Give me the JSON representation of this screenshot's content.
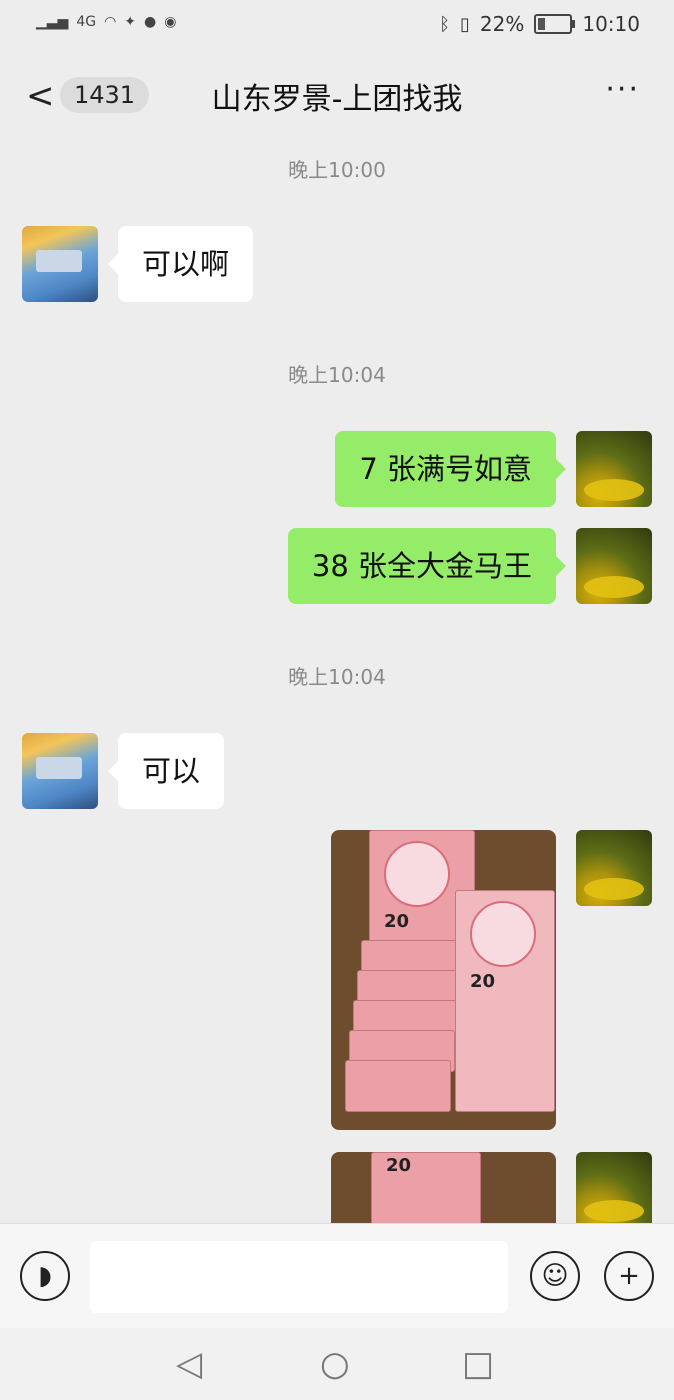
{
  "status_bar": {
    "signal_text": "4G",
    "battery": "22%",
    "battery_level": 0.22,
    "time": "10:10",
    "icons": [
      "signal-icon",
      "wifi-icon",
      "notification-icon",
      "chat-icon",
      "app-icon",
      "bluetooth-icon",
      "vibrate-icon",
      "battery-icon"
    ]
  },
  "header": {
    "back_label": "<",
    "unread_count": "1431",
    "title": "山东罗景-上团找我",
    "more_label": "···"
  },
  "messages": [
    {
      "type": "time",
      "text": "晚上10:00"
    },
    {
      "type": "text",
      "side": "left",
      "text": "可以啊"
    },
    {
      "type": "time",
      "text": "晚上10:04"
    },
    {
      "type": "text",
      "side": "right",
      "text": "7 张满号如意"
    },
    {
      "type": "text",
      "side": "right",
      "text": "38 张全大金马王"
    },
    {
      "type": "time",
      "text": "晚上10:04"
    },
    {
      "type": "text",
      "side": "left",
      "text": "可以"
    },
    {
      "type": "image",
      "side": "right",
      "denomination": "20"
    },
    {
      "type": "image",
      "side": "right",
      "denomination": "20"
    }
  ],
  "input_bar": {
    "voice_icon": "voice-icon",
    "emoji_icon": "emoji-icon",
    "add_label": "+",
    "text_value": ""
  },
  "nav_bar": {
    "back_label": "◁",
    "home_label": "○",
    "recents_label": "□"
  },
  "colors": {
    "background": "#ededed",
    "self_bubble": "#95ec69",
    "other_bubble": "#ffffff"
  }
}
